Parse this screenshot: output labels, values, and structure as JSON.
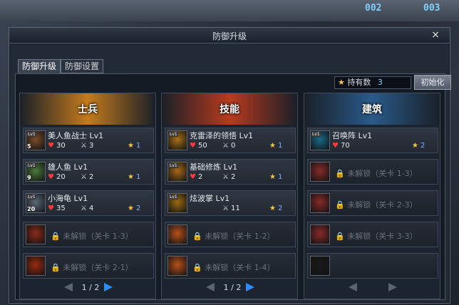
{
  "top_stats": [
    "002",
    "003"
  ],
  "dialog": {
    "title": "防御升级",
    "close_glyph": "×"
  },
  "tabs": [
    {
      "label": "防御升级",
      "active": true
    },
    {
      "label": "防御设置",
      "active": false
    }
  ],
  "owned": {
    "label": "持有数",
    "value": "3"
  },
  "reset_label": "初始化",
  "columns": [
    {
      "title": "士兵",
      "banner_color": "#c47a1c",
      "page": "1 / 2",
      "slots": [
        {
          "name": "美人鱼战士 Lv1",
          "hp": "30",
          "atk": "3",
          "cost": "1",
          "stage": "5",
          "portrait_color": "#7a4a2a"
        },
        {
          "name": "雄人鱼 Lv1",
          "hp": "20",
          "atk": "2",
          "cost": "1",
          "stage": "9",
          "portrait_color": "#4a7a3a"
        },
        {
          "name": "小海龟 Lv1",
          "hp": "35",
          "atk": "4",
          "cost": "2",
          "stage": "20",
          "portrait_color": "#5a6a7a"
        },
        {
          "locked": true,
          "label": "未解锁（关卡 1-3）",
          "portrait_color": "#8a2a1a"
        },
        {
          "locked": true,
          "label": "未解锁（关卡 2-1）",
          "portrait_color": "#9a2a10"
        }
      ]
    },
    {
      "title": "技能",
      "banner_color": "#b83a1e",
      "page": "1 / 2",
      "slots": [
        {
          "name": "克雷泽的领悟 Lv1",
          "hp": "50",
          "atk": "0",
          "cost": "1",
          "stage": "",
          "portrait_color": "#a87018"
        },
        {
          "name": "基础修炼 Lv1",
          "hp": "2",
          "atk": "2",
          "cost": "1",
          "stage": "",
          "portrait_color": "#a86818"
        },
        {
          "name": "炫波掌 Lv1",
          "hp": "",
          "atk": "11",
          "cost": "2",
          "stage": "",
          "portrait_color": "#9a6a10"
        },
        {
          "locked": true,
          "label": "未解锁（关卡 1-2）",
          "portrait_color": "#b8501a"
        },
        {
          "locked": true,
          "label": "未解锁（关卡 1-4）",
          "portrait_color": "#b8501a"
        }
      ]
    },
    {
      "title": "建筑",
      "banner_color": "#2a5a8a",
      "page": "",
      "slots": [
        {
          "name": "召唤阵 Lv1",
          "hp": "70",
          "atk": "",
          "cost": "2",
          "stage": "",
          "portrait_color": "#1a6a8a"
        },
        {
          "locked": true,
          "label": "未解锁（关卡 1-3）",
          "portrait_color": "#8a2a2a"
        },
        {
          "locked": true,
          "label": "未解锁（关卡 2-3）",
          "portrait_color": "#8a2a2a"
        },
        {
          "locked": true,
          "label": "未解锁（关卡 3-3）",
          "portrait_color": "#8a2a2a"
        },
        {
          "locked": true,
          "label": "",
          "portrait_color": "#1a1a1a"
        }
      ]
    }
  ]
}
